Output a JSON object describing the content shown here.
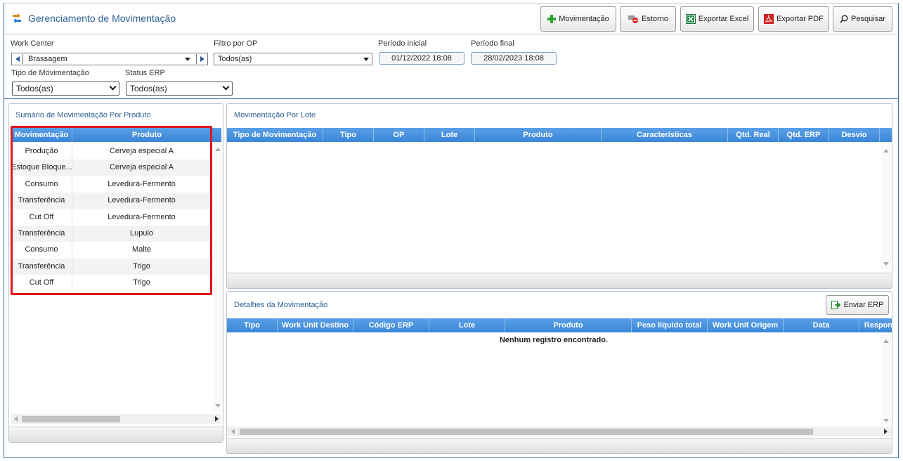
{
  "header": {
    "title": "Gerenciamento de Movimentação",
    "buttons": {
      "movimentacao": "Movimentação",
      "estorno": "Estorno",
      "exportar_excel": "Exportar Excel",
      "exportar_pdf": "Exportar PDF",
      "pesquisar": "Pesquisar"
    }
  },
  "filters": {
    "work_center": {
      "label": "Work Center",
      "value": "Brassagem"
    },
    "filtro_op": {
      "label": "Filtro por OP",
      "value": "Todos(as)"
    },
    "periodo_inicial": {
      "label": "Período inicial",
      "value": "01/12/2022 18:08"
    },
    "periodo_final": {
      "label": "Período final",
      "value": "28/02/2023 18:08"
    },
    "tipo_movimentacao": {
      "label": "Tipo de Movimentação",
      "value": "Todos(as)"
    },
    "status_erp": {
      "label": "Status ERP",
      "value": "Todos(as)"
    }
  },
  "summary": {
    "title": "Sumário de Movimentação Por Produto",
    "columns": [
      "Movimentação",
      "Produto"
    ],
    "rows": [
      {
        "movimentacao": "Produção",
        "produto": "Cerveja especial A"
      },
      {
        "movimentacao": "Estoque Bloque...",
        "produto": "Cerveja especial A"
      },
      {
        "movimentacao": "Consumo",
        "produto": "Levedura-Fermento"
      },
      {
        "movimentacao": "Transferência",
        "produto": "Levedura-Fermento"
      },
      {
        "movimentacao": "Cut Off",
        "produto": "Levedura-Fermento"
      },
      {
        "movimentacao": "Transferência",
        "produto": "Lupulo"
      },
      {
        "movimentacao": "Consumo",
        "produto": "Malte"
      },
      {
        "movimentacao": "Transferência",
        "produto": "Trigo"
      },
      {
        "movimentacao": "Cut Off",
        "produto": "Trigo"
      }
    ]
  },
  "lote": {
    "title": "Movimentação Por Lote",
    "columns": [
      "Tipo de Movimentação",
      "Tipo",
      "OP",
      "Lote",
      "Produto",
      "Características",
      "Qtd. Real",
      "Qtd. ERP",
      "Desvio"
    ]
  },
  "detalhes": {
    "title": "Detalhes da Movimentação",
    "enviar_erp": "Enviar ERP",
    "columns": [
      "Tipo",
      "Work Unit Destino",
      "Código ERP",
      "Lote",
      "Produto",
      "Peso líquido total",
      "Work Unit Origem",
      "Data",
      "Respons"
    ],
    "empty_message": "Nenhum registro encontrado."
  },
  "colors": {
    "accent": "#3b86d8",
    "title_blue": "#2d5f95",
    "highlight": "#e0141e"
  }
}
